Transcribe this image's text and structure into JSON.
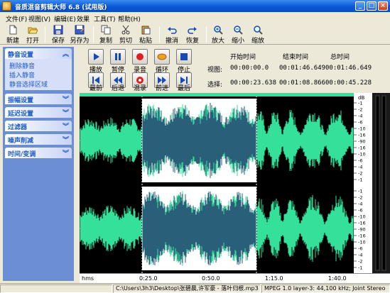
{
  "window": {
    "title": "音质混音剪辑大师 6.8 (试用版)"
  },
  "menu": [
    "文件(F)",
    "视图(V)",
    "编辑(E)",
    "效果",
    "工具(T)",
    "帮助(H)"
  ],
  "toolbar": {
    "new": "新建",
    "open": "打开",
    "save": "保存",
    "save_as": "另存为",
    "copy": "复制",
    "cut": "剪切",
    "paste": "粘贴",
    "undo": "撤消",
    "redo": "恢复",
    "zoom_in": "放大",
    "zoom_out": "缩小",
    "zoom": "缩放"
  },
  "sidebar": {
    "sections": [
      {
        "title": "静音设置",
        "items": [
          "删除静音",
          "插入静音",
          "静音选择区域"
        ]
      },
      {
        "title": "振幅设置",
        "items": []
      },
      {
        "title": "延迟设置",
        "items": []
      },
      {
        "title": "过滤器",
        "items": []
      },
      {
        "title": "噪声削减",
        "items": []
      },
      {
        "title": "时间/变调",
        "items": []
      }
    ]
  },
  "transport": {
    "play": "播放",
    "pause": "暂停",
    "record": "录音",
    "loop": "循环",
    "stop": "停止",
    "first": "最前",
    "back": "后退",
    "mix": "混录",
    "forward": "前进",
    "last": "最后"
  },
  "timeinfo": {
    "col_start": "开始时间",
    "col_end": "结束时间",
    "col_total": "总时间",
    "view_label": "视图:",
    "view_start": "00:00:00.0",
    "view_end": "00:01:46.649",
    "view_total": "00:01:46.649",
    "sel_label": "选择:",
    "sel_start": "00:00:23.638",
    "sel_end": "00:01:08.866",
    "sel_total": "00:00:45.228"
  },
  "ruler": {
    "db_label": "dB",
    "db_ticks": [
      "-1",
      "-2",
      "-4",
      "-6",
      "-10",
      "-16",
      "-90",
      "-16",
      "-10",
      "-6",
      "-4",
      "-2",
      "-1"
    ],
    "time_labels": [
      "hms",
      "0:25.0",
      "0:50.0",
      "1:15.0",
      "1:40.0"
    ]
  },
  "colors": {
    "waveform": "#35e09a",
    "selection_wave": "#2a5f7a",
    "selection_bg": "#ffffff",
    "background": "#000000"
  },
  "statusbar": {
    "path": "C:\\Users\\3h3\\Desktop\\张碧晨,许军豪 - 落叶归根.mp3",
    "format": "MPEG 1.0 layer-3: 44,100 kHz; Joint Stereo"
  }
}
